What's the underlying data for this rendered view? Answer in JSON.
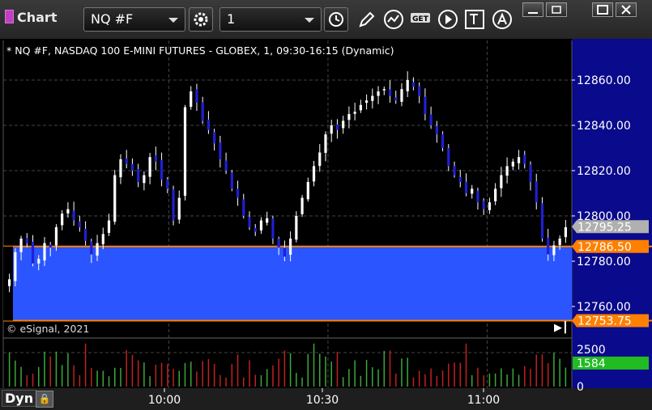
{
  "toolbar": {
    "title": "Chart",
    "symbol": "NQ #F",
    "interval": "1",
    "icons": [
      "gear-icon",
      "clock-icon",
      "pencil-icon",
      "study-icon",
      "get-icon",
      "play-icon",
      "text-tool-icon",
      "alert-icon"
    ]
  },
  "window_controls": [
    "help-icon",
    "restore-icon",
    "maximize-icon",
    "close-icon"
  ],
  "chart_header": "* NQ #F, NASDAQ 100 E-MINI FUTURES - GLOBEX, 1, 09:30-16:15 (Dynamic)",
  "copyright": "© eSignal, 2021",
  "footer": {
    "mode": "Dyn"
  },
  "colors": {
    "background": "#000000",
    "axis_panel": "#0a0a8c",
    "up_candle": "#ffffff",
    "down_candle": "#2020d0",
    "zone_fill": "#2a55ff",
    "zone_line": "#ff8000",
    "volume_up": "#3aa83a",
    "volume_down": "#c02020"
  },
  "chart_data": [
    {
      "type": "candlestick",
      "y_axis": {
        "ticks": [
          "12860.00",
          "12840.00",
          "12820.00",
          "12800.00",
          "12780.00",
          "12760.00"
        ],
        "range": [
          12752,
          12866
        ]
      },
      "x_axis": {
        "ticks": [
          "10:00",
          "10:30",
          "11:00"
        ]
      },
      "price_markers": [
        {
          "label": "12795.25",
          "value": 12795.25,
          "color": "#b0b0b0",
          "text_color": "#000000"
        },
        {
          "label": "12786.50",
          "value": 12786.5,
          "color": "#ff8000",
          "text_color": "#000000"
        },
        {
          "label": "12753.75",
          "value": 12753.75,
          "color": "#ff8000",
          "text_color": "#000000"
        }
      ],
      "zone": {
        "top": 12786.5,
        "bottom": 12753.75
      },
      "close_path": [
        12772,
        12784,
        12790,
        12788,
        12779,
        12781,
        12788,
        12786,
        12795,
        12801,
        12803,
        12798,
        12795,
        12789,
        12783,
        12788,
        12792,
        12798,
        12818,
        12825,
        12823,
        12820,
        12815,
        12818,
        12826,
        12824,
        12816,
        12812,
        12798,
        12808,
        12848,
        12855,
        12850,
        12842,
        12838,
        12832,
        12825,
        12820,
        12812,
        12808,
        12800,
        12795,
        12793,
        12798,
        12799,
        12790,
        12786,
        12782,
        12790,
        12800,
        12808,
        12815,
        12822,
        12828,
        12836,
        12840,
        12838,
        12842,
        12845,
        12846,
        12849,
        12851,
        12853,
        12855,
        12856,
        12853,
        12851,
        12856,
        12860,
        12857,
        12853,
        12845,
        12840,
        12836,
        12830,
        12822,
        12818,
        12815,
        12810,
        12812,
        12806,
        12803,
        12806,
        12812,
        12818,
        12822,
        12824,
        12826,
        12823,
        12815,
        12806,
        12790,
        12783,
        12787,
        12790,
        12795
      ]
    },
    {
      "type": "bar",
      "name": "Volume",
      "y_axis": {
        "ticks": [
          "2500",
          "0"
        ],
        "range": [
          0,
          3000
        ]
      },
      "last_value_label": "1584",
      "last_value": 1584
    }
  ]
}
